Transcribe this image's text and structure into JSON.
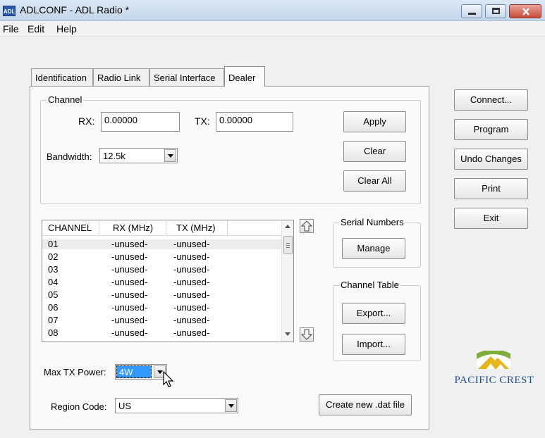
{
  "window": {
    "app_icon": "ADL",
    "title": "ADLCONF - ADL Radio  *"
  },
  "menu": [
    "File",
    "Edit",
    "Help"
  ],
  "tabs": [
    "Identification",
    "Radio Link",
    "Serial Interface",
    "Dealer"
  ],
  "active_tab": "Dealer",
  "channel": {
    "group_label": "Channel",
    "rx_label": "RX:",
    "rx_value": "0.00000",
    "tx_label": "TX:",
    "tx_value": "0.00000",
    "bandwidth_label": "Bandwidth:",
    "bandwidth_value": "12.5k",
    "buttons": [
      "Apply",
      "Clear",
      "Clear All"
    ]
  },
  "channel_list": {
    "columns": [
      "CHANNEL",
      "RX (MHz)",
      "TX (MHz)"
    ],
    "rows": [
      [
        "01",
        "-unused-",
        "-unused-"
      ],
      [
        "02",
        "-unused-",
        "-unused-"
      ],
      [
        "03",
        "-unused-",
        "-unused-"
      ],
      [
        "04",
        "-unused-",
        "-unused-"
      ],
      [
        "05",
        "-unused-",
        "-unused-"
      ],
      [
        "06",
        "-unused-",
        "-unused-"
      ],
      [
        "07",
        "-unused-",
        "-unused-"
      ],
      [
        "08",
        "-unused-",
        "-unused-"
      ]
    ]
  },
  "serial_numbers": {
    "group_label": "Serial Numbers",
    "manage": "Manage"
  },
  "channel_table": {
    "group_label": "Channel Table",
    "export": "Export...",
    "import": "Import..."
  },
  "max_tx_power": {
    "label": "Max TX Power:",
    "value": "4W"
  },
  "region_code": {
    "label": "Region Code:",
    "value": "US"
  },
  "create_dat": "Create new .dat file",
  "side_buttons": [
    "Connect...",
    "Program",
    "Undo Changes",
    "Print",
    "Exit"
  ],
  "logo": {
    "text": "PACIFIC CREST",
    "icons": "mountain-logo"
  },
  "colors": {
    "selection": "#3399ff",
    "logo_text": "#1f4f8f",
    "logo_green": "#7fae3a",
    "logo_gold": "#e6b51b"
  }
}
